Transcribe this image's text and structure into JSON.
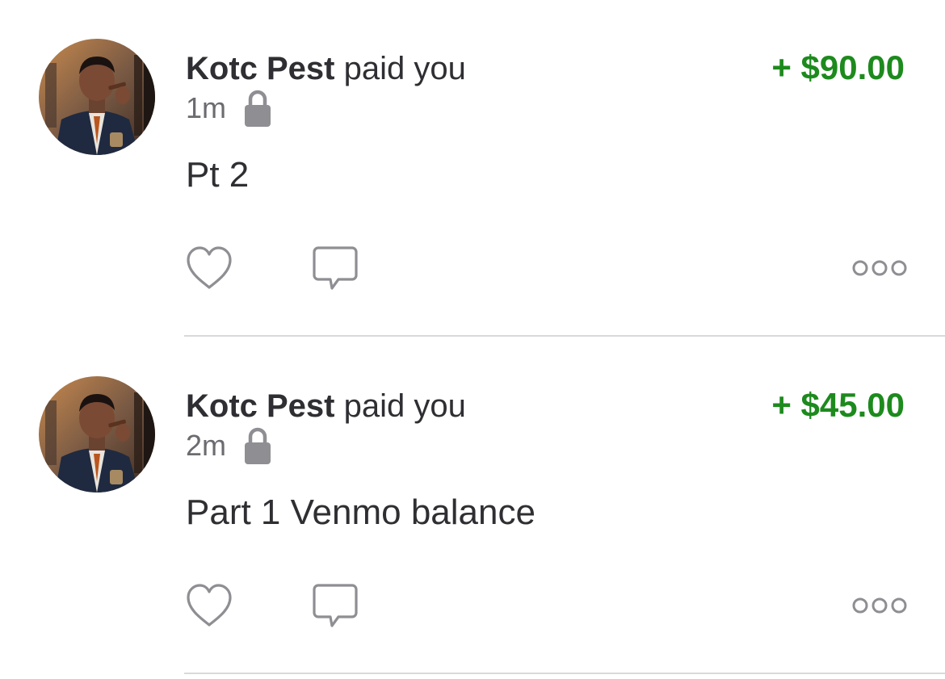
{
  "stories": [
    {
      "actor": "Kotc Pest",
      "verb": "paid you",
      "amount": "+ $90.00",
      "time": "1m",
      "note": "Pt 2"
    },
    {
      "actor": "Kotc Pest",
      "verb": "paid you",
      "amount": "+ $45.00",
      "time": "2m",
      "note": "Part 1 Venmo balance"
    }
  ],
  "icons": {
    "privacy": "lock-icon",
    "like": "heart-icon",
    "comment": "comment-icon",
    "more": "more-options-icon"
  },
  "colors": {
    "amount_positive": "#1d8a1d",
    "text_primary": "#2f2f33",
    "text_secondary": "#6b6b70",
    "icon_gray": "#8e8e93",
    "divider": "#d9d9dc"
  }
}
